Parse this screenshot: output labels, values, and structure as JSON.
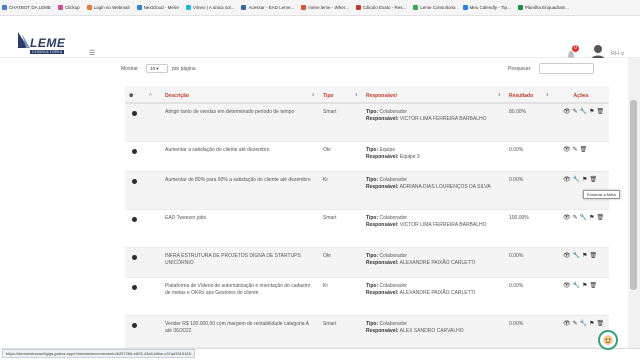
{
  "bookmarks": [
    {
      "label": "CHATBOT DA LEME",
      "color": "#4a7bd0"
    },
    {
      "label": "Clickup",
      "color": "#d04a90"
    },
    {
      "label": "Login no Webmail",
      "color": "#e07b3a"
    },
    {
      "label": "Nextcloud - Meire",
      "color": "#2d7fd6"
    },
    {
      "label": "Vimeo | A única sol...",
      "color": "#1fb6e8"
    },
    {
      "label": "Acessar - EAD Leme...",
      "color": "#3a66b0"
    },
    {
      "label": "meire.leme - Wher...",
      "color": "#d9532b"
    },
    {
      "label": "Cálculo Exato - Res...",
      "color": "#c0392b"
    },
    {
      "label": "Leme Consultoria",
      "color": "#34a853"
    },
    {
      "label": "Meu Calendly - Tip...",
      "color": "#2b7de9"
    },
    {
      "label": "Planilha Enquadram...",
      "color": "#1e8e3e"
    }
  ],
  "header": {
    "logo_text": "LEME",
    "logo_sub": "CONSULTORIA",
    "notification_count": "0",
    "user_name": "RH"
  },
  "controls": {
    "show_label": "Mostrar",
    "page_length": "10",
    "per_page": "por página",
    "search_label": "Pesquisar:"
  },
  "columns": {
    "descricao": "Descrição",
    "tipo": "Tipo",
    "responsavel": "Responsável",
    "resultado": "Resultado",
    "acoes": "Ações"
  },
  "tipo_label": "Tipo:",
  "resp_label": "Responsável:",
  "rows": [
    {
      "desc": "Atingir tanto de vendas em determinado período de tempo",
      "tipo": "Smart",
      "tipo_val": "Colaborador",
      "resp": "VICTOR LIMA FERREIRA BARBALHO",
      "resultado": "80.00%"
    },
    {
      "desc": "Aumentar a satisfação do cliente até dezembro",
      "tipo": "Okr",
      "tipo_val": "Equipe",
      "resp": "Equipe 3",
      "resultado": "0.00%"
    },
    {
      "desc": "Aumentar de 80% para 90% a satisfação do cliente até dezembro",
      "tipo": "Kr",
      "tipo_val": "Colaborador",
      "resp": "ADRIANA DIAS LOURENÇOS DA SILVA",
      "resultado": "0.00%"
    },
    {
      "desc": "EAD Tweezer jobs",
      "tipo": "Smart",
      "tipo_val": "Colaborador",
      "resp": "VICTOR LIMA FERREIRA BARBALHO",
      "resultado": "100.00%"
    },
    {
      "desc": "INFRA ESTRUTURA DE PROJETOS DIGNA DE STARTUPS UNICÓRNIO",
      "tipo": "Okr",
      "tipo_val": "Colaborador",
      "resp": "ALEXANDRE PAIXÃO CARLETTI",
      "resultado": "0.00%"
    },
    {
      "desc": "Plataforma de Vídeos de automatização e orientação do cadastro de metas e OKRs aos Gestores do cliente",
      "tipo": "Kr",
      "tipo_val": "Colaborador",
      "resp": "ALEXANDRE PAIXÃO CARLETTI",
      "resultado": "0.00%"
    },
    {
      "desc": "Vender R$ 100.000,00 com margem de rentabilidade categoria A até 06/2022",
      "tipo": "Smart",
      "tipo_val": "Colaborador",
      "resp": "ALEX SANDRO CARVALHO",
      "resultado": "0.00%"
    }
  ],
  "tooltip": "Encerrar a Meta",
  "status_url": "https://demonstracao5giga.galera.app/rh/metas/encerramento/b297266-e803-43e8-b6be-c37ad3315183"
}
